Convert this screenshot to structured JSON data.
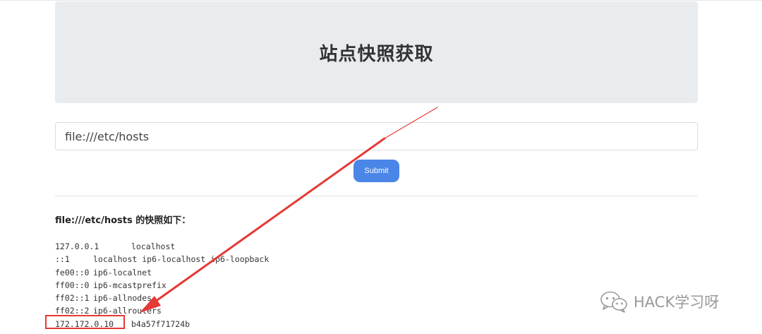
{
  "header": {
    "title": "站点快照获取"
  },
  "form": {
    "url_value": "file:///etc/hosts",
    "submit_label": "Submit"
  },
  "result": {
    "heading": "file:///etc/hosts 的快照如下："
  },
  "hosts": [
    {
      "address": "127.0.0.1",
      "names": "localhost"
    },
    {
      "address": "::1",
      "names": "localhost ip6-localhost ip6-loopback"
    },
    {
      "address": "fe00::0",
      "names": "ip6-localnet"
    },
    {
      "address": "ff00::0",
      "names": "ip6-mcastprefix"
    },
    {
      "address": "ff02::1",
      "names": "ip6-allnodes"
    },
    {
      "address": "ff02::2",
      "names": "ip6-allrouters"
    },
    {
      "address": "172.172.0.10",
      "names": "b4a57f71724b"
    }
  ],
  "annotation": {
    "color": "#e53935",
    "icon": "arrow-icon"
  },
  "watermark": {
    "text": "HACK学习呀",
    "icon": "wechat-icon"
  },
  "colors": {
    "button": "#4a86e8",
    "jumbotron": "#e9ecef"
  }
}
